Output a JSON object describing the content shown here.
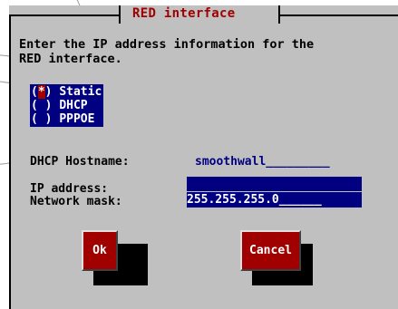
{
  "dialog": {
    "title": "RED interface",
    "prompt": "Enter the IP address information for the\nRED interface."
  },
  "connection_options": [
    {
      "mark": "*",
      "label": "Static",
      "selected": true
    },
    {
      "mark": " ",
      "label": "DHCP",
      "selected": false
    },
    {
      "mark": " ",
      "label": "PPPOE",
      "selected": false
    }
  ],
  "fields": {
    "dhcp_hostname_label": "DHCP Hostname:",
    "dhcp_hostname_value": "smoothwall_________",
    "ip_address_label": "IP address:",
    "ip_address_value": "",
    "network_mask_label": "Network mask:",
    "network_mask_value": "255.255.255.0______"
  },
  "buttons": {
    "ok_label": "Ok",
    "cancel_label": "Cancel"
  },
  "colors": {
    "dialog_bg": "#c0c0c0",
    "accent_red": "#a00000",
    "selection_blue": "#000080"
  }
}
